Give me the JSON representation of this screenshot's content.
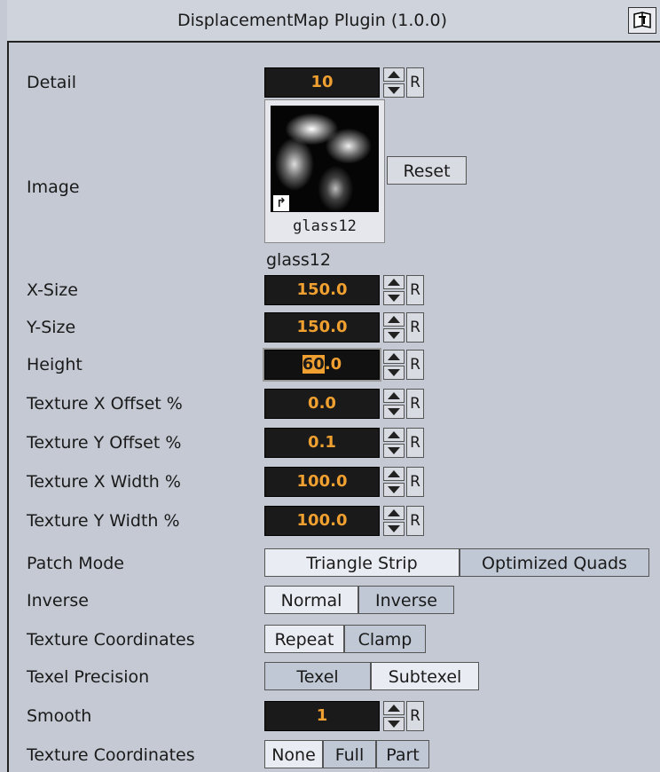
{
  "header": {
    "title": "DisplacementMap Plugin (1.0.0)",
    "help_icon": "help-book-icon"
  },
  "fields": {
    "detail": {
      "label": "Detail",
      "value": "10"
    },
    "image": {
      "label": "Image",
      "thumb_caption": "glass12",
      "name": "glass12",
      "reset_label": "Reset"
    },
    "x_size": {
      "label": "X-Size",
      "value": "150.0"
    },
    "y_size": {
      "label": "Y-Size",
      "value": "150.0"
    },
    "height": {
      "label": "Height",
      "value_selected": "60",
      "value_rest": ".0"
    },
    "tex_x_offset": {
      "label": "Texture X Offset %",
      "value": "0.0"
    },
    "tex_y_offset": {
      "label": "Texture Y Offset %",
      "value": "0.1"
    },
    "tex_x_width": {
      "label": "Texture X Width %",
      "value": "100.0"
    },
    "tex_y_width": {
      "label": "Texture Y Width %",
      "value": "100.0"
    },
    "smooth": {
      "label": "Smooth",
      "value": "1"
    }
  },
  "reset_label": "R",
  "patch_mode": {
    "label": "Patch Mode",
    "options": [
      "Triangle Strip",
      "Optimized Quads"
    ],
    "selected": "Triangle Strip"
  },
  "inverse": {
    "label": "Inverse",
    "options": [
      "Normal",
      "Inverse"
    ],
    "selected": "Normal"
  },
  "texture_coordinates": {
    "label": "Texture Coordinates",
    "options": [
      "Repeat",
      "Clamp"
    ],
    "selected": "Repeat"
  },
  "texel_precision": {
    "label": "Texel Precision",
    "options": [
      "Texel",
      "Subtexel"
    ],
    "selected": "Subtexel"
  },
  "texture_coordinates_2": {
    "label": "Texture Coordinates",
    "options": [
      "None",
      "Full",
      "Part"
    ],
    "selected": "None"
  },
  "colors": {
    "field_bg": "#1a1a1a",
    "field_text": "#f0a030",
    "panel_bg": "#c4c9d3",
    "seg_selected": "#e9ecf3",
    "seg_unselected": "#bfc8d4"
  }
}
